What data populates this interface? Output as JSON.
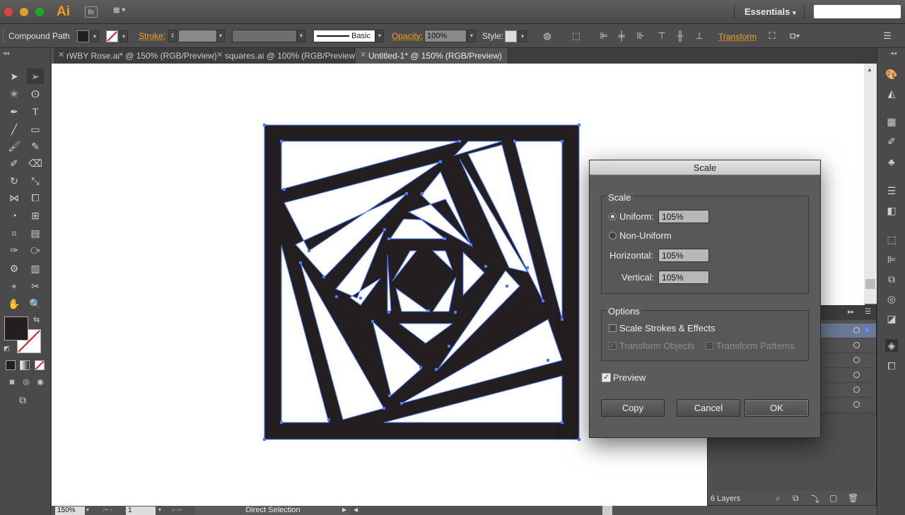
{
  "app": {
    "logo": "Ai",
    "bridge": "Br",
    "workspace": "Essentials"
  },
  "control_bar": {
    "selection_type": "Compound Path",
    "stroke_label": "Stroke:",
    "brush_label": "Basic",
    "opacity_label": "Opacity:",
    "opacity_value": "100%",
    "style_label": "Style:",
    "transform_label": "Transform"
  },
  "tabs": [
    {
      "label": "rWBY Rose.ai* @ 150% (RGB/Preview)"
    },
    {
      "label": "squares.ai @ 100% (RGB/Preview)"
    },
    {
      "label": "Untitled-1* @ 150% (RGB/Preview)"
    }
  ],
  "status": {
    "zoom": "150%",
    "artboard": "1",
    "tool": "Direct Selection"
  },
  "layers_panel": {
    "count_label": "6 Layers"
  },
  "dialog": {
    "title": "Scale",
    "scale_group": "Scale",
    "uniform_label": "Uniform:",
    "uniform_value": "105%",
    "nonuniform_label": "Non-Uniform",
    "horizontal_label": "Horizontal:",
    "horizontal_value": "105%",
    "vertical_label": "Vertical:",
    "vertical_value": "105%",
    "options_group": "Options",
    "scale_strokes_label": "Scale Strokes & Effects",
    "transform_objects_label": "Transform Objects",
    "transform_patterns_label": "Transform Patterns",
    "preview_label": "Preview",
    "copy_label": "Copy",
    "cancel_label": "Cancel",
    "ok_label": "OK"
  },
  "colors": {
    "accent_orange": "#f0a030",
    "selection_blue": "#4a78ff",
    "artwork_fill": "#231f20"
  }
}
